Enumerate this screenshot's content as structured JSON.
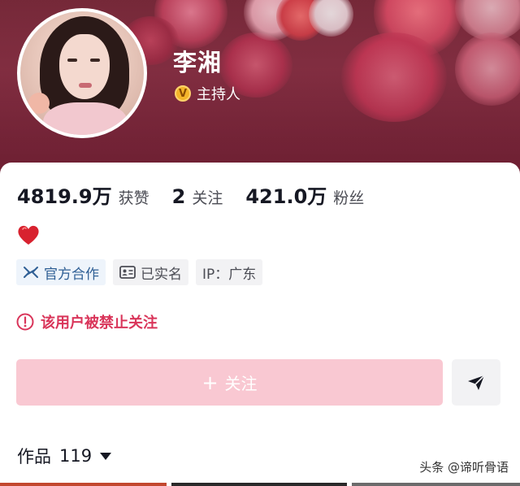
{
  "profile": {
    "name": "李湘",
    "verify_icon": "V",
    "verify_label": "主持人"
  },
  "stats": [
    {
      "value": "4819.9万",
      "label": "获赞"
    },
    {
      "value": "2",
      "label": "关注"
    },
    {
      "value": "421.0万",
      "label": "粉丝"
    }
  ],
  "bio": {
    "emoji_icon": "heart-icon"
  },
  "tags": [
    {
      "label": "官方合作",
      "icon": "official-partner-icon"
    },
    {
      "label": "已实名",
      "icon": "id-card-icon"
    },
    {
      "label": "IP：广东",
      "icon": null
    }
  ],
  "notice": {
    "text": "该用户被禁止关注",
    "icon": "warning-circle-icon"
  },
  "actions": {
    "follow_label": "关注",
    "follow_icon": "+",
    "message_icon": "send-icon"
  },
  "works": {
    "label": "作品",
    "count": "119"
  },
  "watermark": "头条 @谛听骨语",
  "colors": {
    "accent_pink": "#f9c8d2",
    "warning_red": "#d9355a",
    "official_blue": "#2f5f95",
    "verify_gold": "#f4b42a"
  }
}
